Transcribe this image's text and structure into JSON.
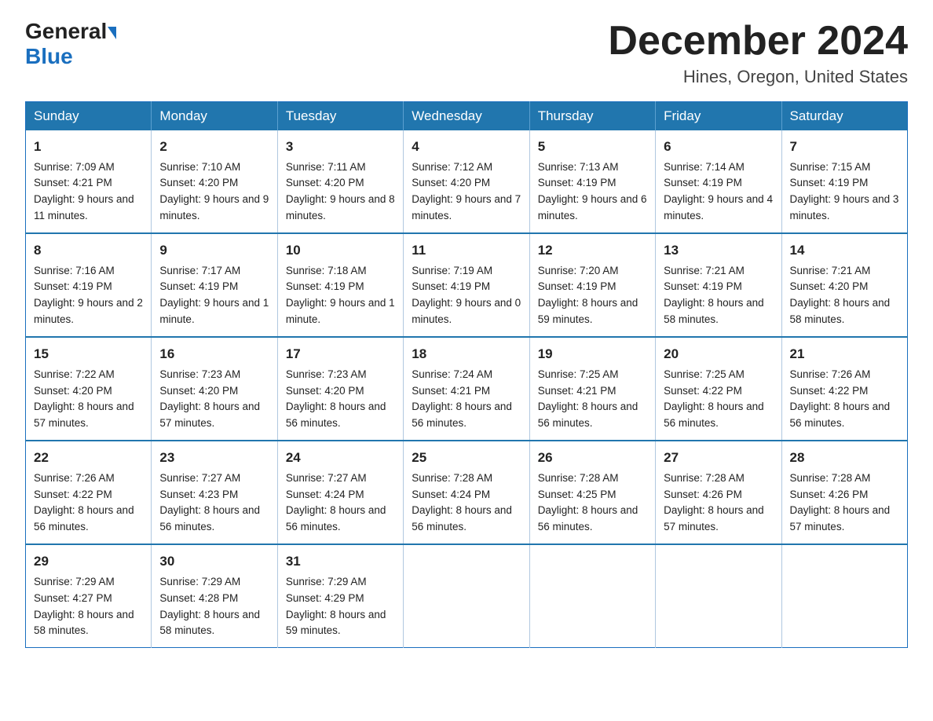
{
  "header": {
    "logo_general": "General",
    "logo_blue": "Blue",
    "month_title": "December 2024",
    "location": "Hines, Oregon, United States"
  },
  "days_of_week": [
    "Sunday",
    "Monday",
    "Tuesday",
    "Wednesday",
    "Thursday",
    "Friday",
    "Saturday"
  ],
  "weeks": [
    [
      {
        "day": "1",
        "sunrise": "7:09 AM",
        "sunset": "4:21 PM",
        "daylight": "9 hours and 11 minutes."
      },
      {
        "day": "2",
        "sunrise": "7:10 AM",
        "sunset": "4:20 PM",
        "daylight": "9 hours and 9 minutes."
      },
      {
        "day": "3",
        "sunrise": "7:11 AM",
        "sunset": "4:20 PM",
        "daylight": "9 hours and 8 minutes."
      },
      {
        "day": "4",
        "sunrise": "7:12 AM",
        "sunset": "4:20 PM",
        "daylight": "9 hours and 7 minutes."
      },
      {
        "day": "5",
        "sunrise": "7:13 AM",
        "sunset": "4:19 PM",
        "daylight": "9 hours and 6 minutes."
      },
      {
        "day": "6",
        "sunrise": "7:14 AM",
        "sunset": "4:19 PM",
        "daylight": "9 hours and 4 minutes."
      },
      {
        "day": "7",
        "sunrise": "7:15 AM",
        "sunset": "4:19 PM",
        "daylight": "9 hours and 3 minutes."
      }
    ],
    [
      {
        "day": "8",
        "sunrise": "7:16 AM",
        "sunset": "4:19 PM",
        "daylight": "9 hours and 2 minutes."
      },
      {
        "day": "9",
        "sunrise": "7:17 AM",
        "sunset": "4:19 PM",
        "daylight": "9 hours and 1 minute."
      },
      {
        "day": "10",
        "sunrise": "7:18 AM",
        "sunset": "4:19 PM",
        "daylight": "9 hours and 1 minute."
      },
      {
        "day": "11",
        "sunrise": "7:19 AM",
        "sunset": "4:19 PM",
        "daylight": "9 hours and 0 minutes."
      },
      {
        "day": "12",
        "sunrise": "7:20 AM",
        "sunset": "4:19 PM",
        "daylight": "8 hours and 59 minutes."
      },
      {
        "day": "13",
        "sunrise": "7:21 AM",
        "sunset": "4:19 PM",
        "daylight": "8 hours and 58 minutes."
      },
      {
        "day": "14",
        "sunrise": "7:21 AM",
        "sunset": "4:20 PM",
        "daylight": "8 hours and 58 minutes."
      }
    ],
    [
      {
        "day": "15",
        "sunrise": "7:22 AM",
        "sunset": "4:20 PM",
        "daylight": "8 hours and 57 minutes."
      },
      {
        "day": "16",
        "sunrise": "7:23 AM",
        "sunset": "4:20 PM",
        "daylight": "8 hours and 57 minutes."
      },
      {
        "day": "17",
        "sunrise": "7:23 AM",
        "sunset": "4:20 PM",
        "daylight": "8 hours and 56 minutes."
      },
      {
        "day": "18",
        "sunrise": "7:24 AM",
        "sunset": "4:21 PM",
        "daylight": "8 hours and 56 minutes."
      },
      {
        "day": "19",
        "sunrise": "7:25 AM",
        "sunset": "4:21 PM",
        "daylight": "8 hours and 56 minutes."
      },
      {
        "day": "20",
        "sunrise": "7:25 AM",
        "sunset": "4:22 PM",
        "daylight": "8 hours and 56 minutes."
      },
      {
        "day": "21",
        "sunrise": "7:26 AM",
        "sunset": "4:22 PM",
        "daylight": "8 hours and 56 minutes."
      }
    ],
    [
      {
        "day": "22",
        "sunrise": "7:26 AM",
        "sunset": "4:22 PM",
        "daylight": "8 hours and 56 minutes."
      },
      {
        "day": "23",
        "sunrise": "7:27 AM",
        "sunset": "4:23 PM",
        "daylight": "8 hours and 56 minutes."
      },
      {
        "day": "24",
        "sunrise": "7:27 AM",
        "sunset": "4:24 PM",
        "daylight": "8 hours and 56 minutes."
      },
      {
        "day": "25",
        "sunrise": "7:28 AM",
        "sunset": "4:24 PM",
        "daylight": "8 hours and 56 minutes."
      },
      {
        "day": "26",
        "sunrise": "7:28 AM",
        "sunset": "4:25 PM",
        "daylight": "8 hours and 56 minutes."
      },
      {
        "day": "27",
        "sunrise": "7:28 AM",
        "sunset": "4:26 PM",
        "daylight": "8 hours and 57 minutes."
      },
      {
        "day": "28",
        "sunrise": "7:28 AM",
        "sunset": "4:26 PM",
        "daylight": "8 hours and 57 minutes."
      }
    ],
    [
      {
        "day": "29",
        "sunrise": "7:29 AM",
        "sunset": "4:27 PM",
        "daylight": "8 hours and 58 minutes."
      },
      {
        "day": "30",
        "sunrise": "7:29 AM",
        "sunset": "4:28 PM",
        "daylight": "8 hours and 58 minutes."
      },
      {
        "day": "31",
        "sunrise": "7:29 AM",
        "sunset": "4:29 PM",
        "daylight": "8 hours and 59 minutes."
      },
      null,
      null,
      null,
      null
    ]
  ],
  "labels": {
    "sunrise": "Sunrise:",
    "sunset": "Sunset:",
    "daylight": "Daylight:"
  }
}
